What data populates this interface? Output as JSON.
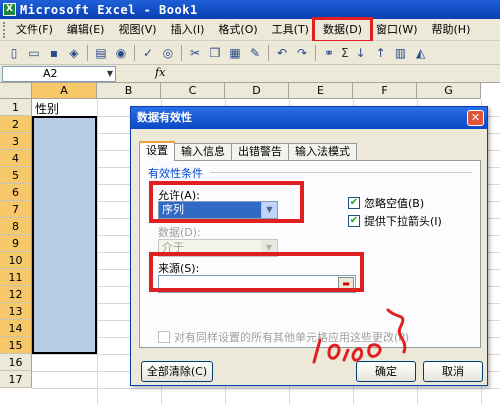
{
  "window": {
    "title": "Microsoft Excel - Book1",
    "app_icon": "excel-icon"
  },
  "menu": {
    "items": [
      {
        "label": "文件(F)"
      },
      {
        "label": "编辑(E)"
      },
      {
        "label": "视图(V)"
      },
      {
        "label": "插入(I)"
      },
      {
        "label": "格式(O)"
      },
      {
        "label": "工具(T)"
      },
      {
        "label": "数据(D)"
      },
      {
        "label": "窗口(W)"
      },
      {
        "label": "帮助(H)"
      }
    ],
    "highlighted": "数据(D)"
  },
  "toolbar": {
    "icons": [
      "new-icon",
      "open-icon",
      "save-icon",
      "permission-icon",
      "email-icon",
      "print-icon",
      "preview-icon",
      "spelling-icon",
      "research-icon",
      "cut-icon",
      "copy-icon",
      "paste-icon",
      "format-painter-icon",
      "undo-icon",
      "redo-icon",
      "hyperlink-icon",
      "autosum-icon",
      "sort-ascending-icon",
      "sort-descending-icon",
      "chart-icon",
      "drawing-icon"
    ],
    "sigma": "Σ"
  },
  "formula_bar": {
    "name_box": "A2",
    "fx": "fx"
  },
  "sheet": {
    "columns": [
      "A",
      "B",
      "C",
      "D",
      "E",
      "F",
      "G"
    ],
    "rows": [
      "1",
      "2",
      "3",
      "4",
      "5",
      "6",
      "7",
      "8",
      "9",
      "10",
      "11",
      "12",
      "13",
      "14",
      "15",
      "16",
      "17"
    ],
    "a1_value": "性别",
    "selected_column": "A"
  },
  "dialog": {
    "title": "数据有效性",
    "tabs": [
      "设置",
      "输入信息",
      "出错警告",
      "输入法模式"
    ],
    "active_tab": "设置",
    "group_label": "有效性条件",
    "allow_label": "允许(A):",
    "allow_value": "序列",
    "data_label": "数据(D):",
    "data_value": "介于",
    "source_label": "来源(S):",
    "source_value": "",
    "ignore_blank_label": "忽略空值(B)",
    "ignore_blank_checked": true,
    "dropdown_label": "提供下拉箭头(I)",
    "dropdown_checked": true,
    "apply_all_label": "对有同样设置的所有其他单元格应用这些更改(P)",
    "apply_all_checked": false,
    "clear_button": "全部清除(C)",
    "ok_button": "确定",
    "cancel_button": "取消"
  },
  "colors": {
    "annotation_red": "#e02020",
    "selection_blue": "#b8cce6",
    "header_highlight": "#f7c86a"
  }
}
